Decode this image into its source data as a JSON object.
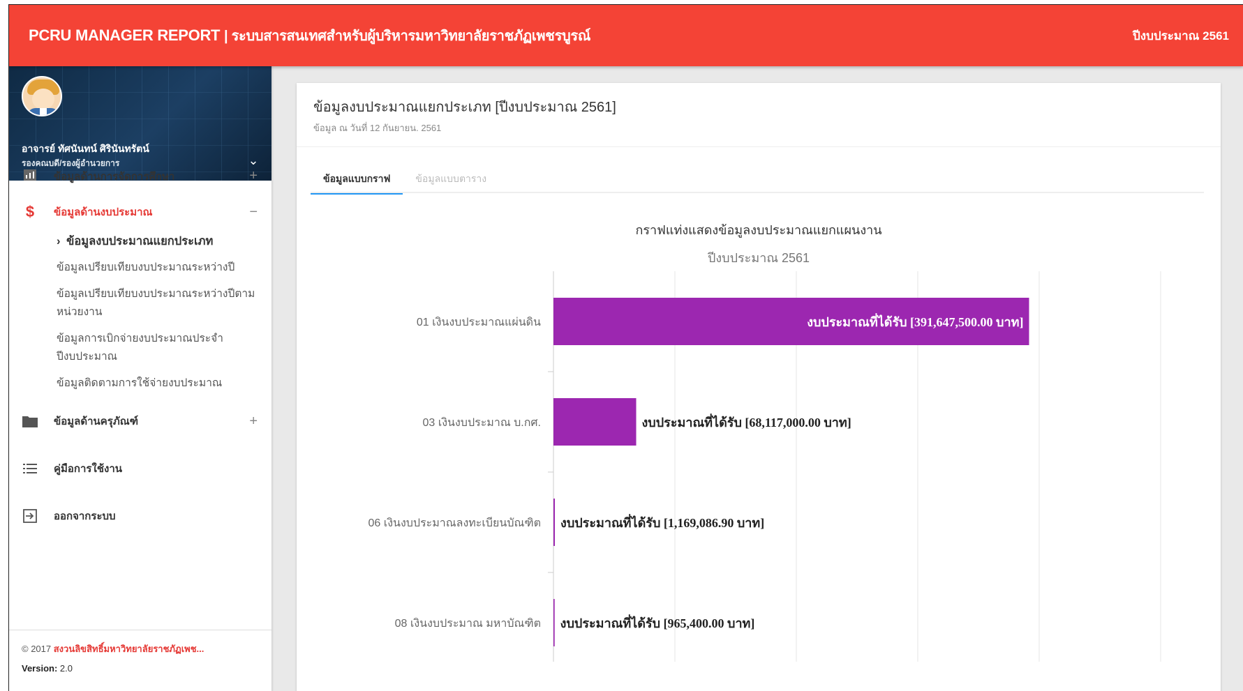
{
  "header": {
    "title": "PCRU MANAGER REPORT",
    "subtitle": "| ระบบสารสนเทศสำหรับผู้บริหารมหาวิทยาลัยราชภัฏเพชรบูรณ์",
    "fiscal_year_label": "ปีงบประมาณ 2561",
    "bg_color": "#f44336"
  },
  "user": {
    "name": "อาจารย์ ทัศนันทน์ ศิรินันทรัตน์",
    "role": "รองคณบดี/รองผู้อำนวยการ"
  },
  "sidebar": {
    "items": [
      {
        "label": "ข้อมูลด้านการจัดการศึกษา",
        "icon": "chart-icon",
        "toggle": "+"
      },
      {
        "label": "ข้อมูลด้านงบประมาณ",
        "icon": "dollar-icon",
        "toggle": "−"
      },
      {
        "label": "ข้อมูลด้านครุภัณฑ์",
        "icon": "folder-icon",
        "toggle": "+"
      },
      {
        "label": "คู่มือการใช้งาน",
        "icon": "list-icon"
      },
      {
        "label": "ออกจากระบบ",
        "icon": "logout-icon"
      }
    ],
    "budget_submenu": [
      "ข้อมูลงบประมาณแยกประเภท",
      "ข้อมูลเปรียบเทียบงบประมาณระหว่างปี",
      "ข้อมูลเปรียบเทียบงบประมาณระหว่างปีตามหน่วยงาน",
      "ข้อมูลการเบิกจ่ายงบประมาณประจำปีงบประมาณ",
      "ข้อมูลติดตามการใช้จ่ายงบประมาณ"
    ],
    "accent_color": "#e53935"
  },
  "footer": {
    "copyright_prefix": "© 2017",
    "copyright_link": "สงวนลิขสิทธิ์มหาวิทยาลัยราชภัฏเพช...",
    "version_label": "Version:",
    "version_value": "2.0"
  },
  "card": {
    "title": "ข้อมูลงบประมาณแยกประเภท [ปีงบประมาณ 2561]",
    "subtitle": "ข้อมูล ณ วันที่ 12 กันยายน. 2561",
    "tabs": [
      "ข้อมูลแบบกราฟ",
      "ข้อมูลแบบตาราง"
    ]
  },
  "chart_data": {
    "type": "bar",
    "orientation": "horizontal",
    "title": "กราฟแท่งแสดงข้อมูลงบประมาณแยกแผนงาน",
    "subtitle": "ปีงบประมาณ 2561",
    "categories": [
      "01 เงินงบประมาณแผ่นดิน",
      "03 เงินงบประมาณ บ.กศ.",
      "06 เงินงบประมาณลงทะเบียนบัณฑิต",
      "08 เงินงบประมาณ มหาบัณฑิต"
    ],
    "values": [
      391647500.0,
      68117000.0,
      1169086.9,
      965400.0
    ],
    "data_labels": [
      "งบประมาณที่ได้รับ [391,647,500.00 บาท]",
      "งบประมาณที่ได้รับ [68,117,000.00 บาท]",
      "งบประมาณที่ได้รับ [1,169,086.90 บาท]",
      "งบประมาณที่ได้รับ [965,400.00 บาท]"
    ],
    "xlim": [
      0,
      500000000
    ],
    "grid": true,
    "bar_color": "#9c27b0"
  }
}
